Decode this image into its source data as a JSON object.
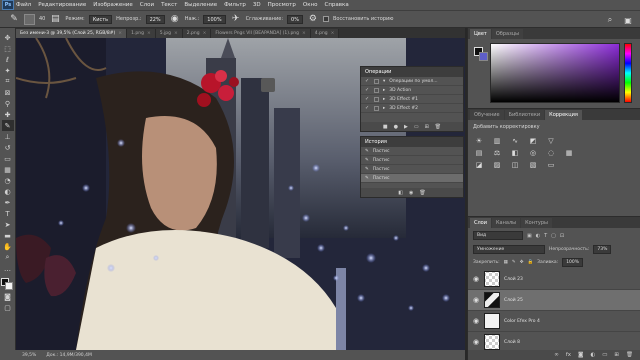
{
  "app": {
    "logo": "Ps"
  },
  "menu": [
    "Файл",
    "Редактирование",
    "Изображение",
    "Слои",
    "Текст",
    "Выделение",
    "Фильтр",
    "3D",
    "Просмотр",
    "Окно",
    "Справка"
  ],
  "options": {
    "brush_size": "40",
    "mode_label": "Режим:",
    "mode_value": "Кисть",
    "opacity_label": "Непрозр.:",
    "opacity_value": "22%",
    "flow_label": "Наж.:",
    "flow_value": "100%",
    "smoothing_label": "Сглаживание:",
    "smoothing_value": "0%",
    "history_label": "Восстановить историю"
  },
  "tabs": [
    {
      "label": "Без имени-3 @ 39,5% (Слой 25, RGB/8#)",
      "active": true
    },
    {
      "label": "1.png",
      "active": false
    },
    {
      "label": "5.jpg",
      "active": false
    },
    {
      "label": "2.png",
      "active": false
    },
    {
      "label": "Flowers Pngs VII [BEAPANDA] (1).png",
      "active": false
    },
    {
      "label": "4.png",
      "active": false
    }
  ],
  "canvas": {
    "bg_color": "#2a2e3a",
    "light_color": "#8fa6ff",
    "flower_color": "#b8142a",
    "skin_color": "#b89078",
    "shirt_color": "#e9e2d2"
  },
  "operations": {
    "title": "Операции",
    "items": [
      {
        "label": "Операции по умол...",
        "expanded": true
      },
      {
        "label": "3D Action",
        "expanded": false
      },
      {
        "label": "3D Effect #1",
        "expanded": false
      },
      {
        "label": "3D Effect #2",
        "expanded": false
      }
    ]
  },
  "history": {
    "title": "История",
    "items": [
      "Пастис",
      "Пастис",
      "Пастис",
      "Пастис"
    ]
  },
  "right": {
    "color_tabs": [
      "Цвет",
      "Образцы"
    ],
    "adj_tabs": [
      "Обучение",
      "Библиотеки",
      "Коррекция"
    ],
    "adj_title": "Добавить корректировку",
    "layers_tabs": [
      "Слои",
      "Каналы",
      "Контуры"
    ],
    "layer_kind": "Вид",
    "blend_mode": "Умножение",
    "opacity_label": "Непрозрачность:",
    "opacity_value": "73%",
    "lock_label": "Закрепить:",
    "fill_label": "Заливка:",
    "fill_value": "100%",
    "layers": [
      {
        "name": "Слой 23",
        "thumb": "checker",
        "selected": false
      },
      {
        "name": "Слой 25",
        "thumb": "art",
        "selected": true
      },
      {
        "name": "Color Efex Pro 4",
        "thumb": "mask",
        "selected": false
      },
      {
        "name": "Слой 8",
        "thumb": "checker",
        "selected": false
      }
    ]
  },
  "status": {
    "zoom": "39,5%",
    "doc": "Док.: 14,9М/390,4М"
  }
}
